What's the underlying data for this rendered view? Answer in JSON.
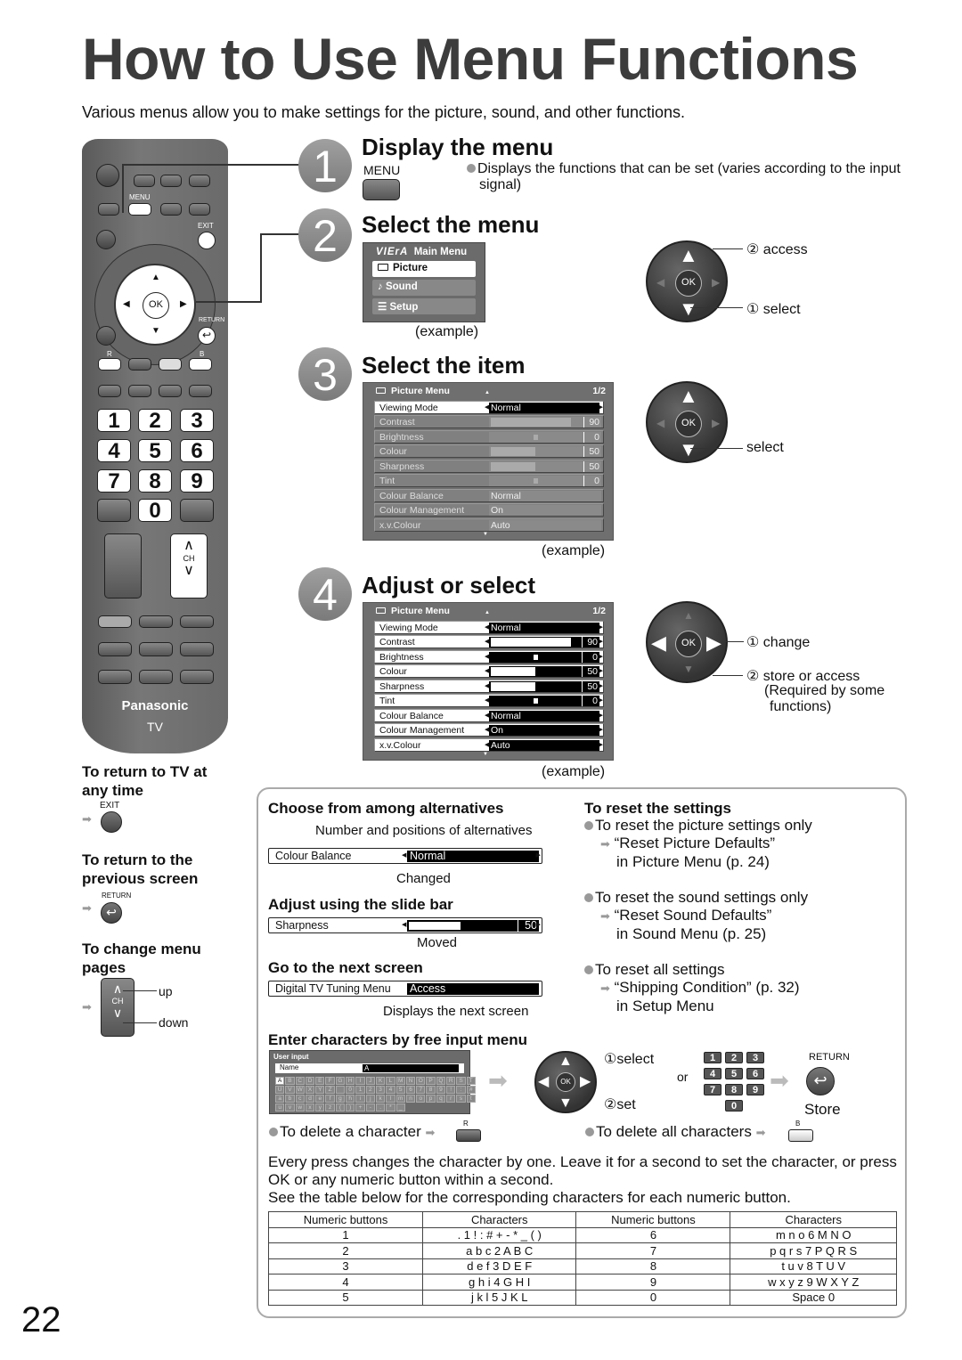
{
  "title": "How to Use Menu Functions",
  "intro": "Various menus allow you to make settings for the picture, sound, and other functions.",
  "remote": {
    "menu_label": "MENU",
    "exit_label": "EXIT",
    "ok_label": "OK",
    "return_label": "RETURN",
    "r_label": "R",
    "b_label": "B",
    "numbers": [
      "1",
      "2",
      "3",
      "4",
      "5",
      "6",
      "7",
      "8",
      "9",
      "0"
    ],
    "ch_label": "CH",
    "brand": "Panasonic",
    "tv_label": "TV"
  },
  "steps": [
    {
      "num": "1",
      "heading": "Display the menu",
      "button_label": "MENU",
      "note": "Displays the functions that can be set (varies according to the input signal)"
    },
    {
      "num": "2",
      "heading": "Select the menu",
      "example": "(example)"
    },
    {
      "num": "3",
      "heading": "Select the item",
      "example": "(example)"
    },
    {
      "num": "4",
      "heading": "Adjust or select",
      "example": "(example)"
    }
  ],
  "main_menu": {
    "brand": "VIErA",
    "title": "Main Menu",
    "items": [
      {
        "label": "Picture",
        "icon": "picture-icon",
        "selected": true
      },
      {
        "label": "Sound",
        "icon": "music-note-icon",
        "selected": false
      },
      {
        "label": "Setup",
        "icon": "list-icon",
        "selected": false
      }
    ]
  },
  "picture_menu": {
    "title": "Picture Menu",
    "page": "1/2",
    "rows": [
      {
        "label": "Viewing Mode",
        "type": "choice",
        "value": "Normal"
      },
      {
        "label": "Contrast",
        "type": "slider",
        "value": "90",
        "fill": 0.9
      },
      {
        "label": "Brightness",
        "type": "center",
        "value": "0"
      },
      {
        "label": "Colour",
        "type": "slider",
        "value": "50",
        "fill": 0.5
      },
      {
        "label": "Sharpness",
        "type": "slider",
        "value": "50",
        "fill": 0.5
      },
      {
        "label": "Tint",
        "type": "center",
        "value": "0"
      },
      {
        "label": "Colour Balance",
        "type": "choice",
        "value": "Normal"
      },
      {
        "label": "Colour Management",
        "type": "choice",
        "value": "On"
      },
      {
        "label": "x.v.Colour",
        "type": "choice",
        "value": "Auto"
      }
    ]
  },
  "callouts": {
    "step2_access": "② access",
    "step2_select": "① select",
    "step3_select": "select",
    "step4_change": "① change",
    "step4_store": "② store or access",
    "step4_required": "(Required by some",
    "step4_functions": "functions)"
  },
  "side_notes": {
    "return_tv": "To return to TV at any time",
    "exit_label": "EXIT",
    "return_prev": "To return to the previous screen",
    "return_label": "RETURN",
    "change_pages": "To change menu pages",
    "ch_label": "CH",
    "up": "up",
    "down": "down"
  },
  "box": {
    "choose": {
      "heading": "Choose from among alternatives",
      "note_top": "Number and positions of alternatives",
      "label": "Colour Balance",
      "value": "Normal",
      "note_bottom": "Changed"
    },
    "slide": {
      "heading": "Adjust using the slide bar",
      "label": "Sharpness",
      "value": "50",
      "fill": 0.5,
      "note_bottom": "Moved"
    },
    "next": {
      "heading": "Go to the next screen",
      "label": "Digital TV Tuning Menu",
      "value": "Access",
      "note_bottom": "Displays the next screen"
    },
    "reset": {
      "heading": "To reset the settings",
      "items": [
        {
          "bullet": "To reset the picture settings only",
          "line1": "“Reset Picture Defaults”",
          "line2": "in Picture Menu (p. 24)"
        },
        {
          "bullet": "To reset the sound settings only",
          "line1": "“Reset Sound Defaults”",
          "line2": "in Sound Menu (p. 25)"
        },
        {
          "bullet": "To reset all settings",
          "line1": "“Shipping Condition” (p. 32)",
          "line2": "in Setup Menu"
        }
      ]
    },
    "free_input": {
      "heading": "Enter characters by free input menu",
      "panel_title": "User input",
      "name_label": "Name",
      "name_value": "A",
      "keys": [
        "A",
        "B",
        "C",
        "D",
        "E",
        "F",
        "G",
        "H",
        "I",
        "J",
        "K",
        "L",
        "M",
        "N",
        "O",
        "P",
        "Q",
        "R",
        "S",
        "T",
        "U",
        "V",
        "W",
        "X",
        "Y",
        "Z",
        " ",
        "0",
        "1",
        "2",
        "3",
        "4",
        "5",
        "6",
        "7",
        "8",
        "9",
        "!",
        ":",
        "#",
        "a",
        "b",
        "c",
        "d",
        "e",
        "f",
        "g",
        "h",
        "i",
        "j",
        "k",
        "l",
        "m",
        "n",
        "o",
        "p",
        "q",
        "r",
        "s",
        "t",
        "u",
        "v",
        "w",
        "x",
        "y",
        "z",
        "(",
        ")",
        "+",
        "-",
        ".",
        "*",
        "_"
      ],
      "select": "①select",
      "set": "②set",
      "or": "or",
      "keypad": [
        "1",
        "2",
        "3",
        "4",
        "5",
        "6",
        "7",
        "8",
        "9",
        "0"
      ],
      "ok_label": "OK",
      "return_label": "RETURN",
      "store": "Store",
      "delete_char": "To delete a character",
      "delete_char_btn": "R",
      "delete_all": "To delete all characters",
      "delete_all_btn": "B"
    },
    "paragraph1": "Every press changes the character by one. Leave it for a second to set the character, or press OK or any numeric button within a second.",
    "paragraph2": "See the table below for the corresponding characters for each numeric button.",
    "table": {
      "headers": [
        "Numeric buttons",
        "Characters",
        "Numeric buttons",
        "Characters"
      ],
      "rows": [
        [
          "1",
          ". 1 ! : # + - * _ ( )",
          "6",
          "m n o 6 M N O"
        ],
        [
          "2",
          "a b c 2 A B C",
          "7",
          "p q r s 7 P Q R S"
        ],
        [
          "3",
          "d e f 3 D E F",
          "8",
          "t u v 8 T U V"
        ],
        [
          "4",
          "g h i 4 G H I",
          "9",
          "w x y z 9 W X Y Z"
        ],
        [
          "5",
          "j k l 5 J K L",
          "0",
          "Space 0"
        ]
      ]
    }
  },
  "page_number": "22"
}
